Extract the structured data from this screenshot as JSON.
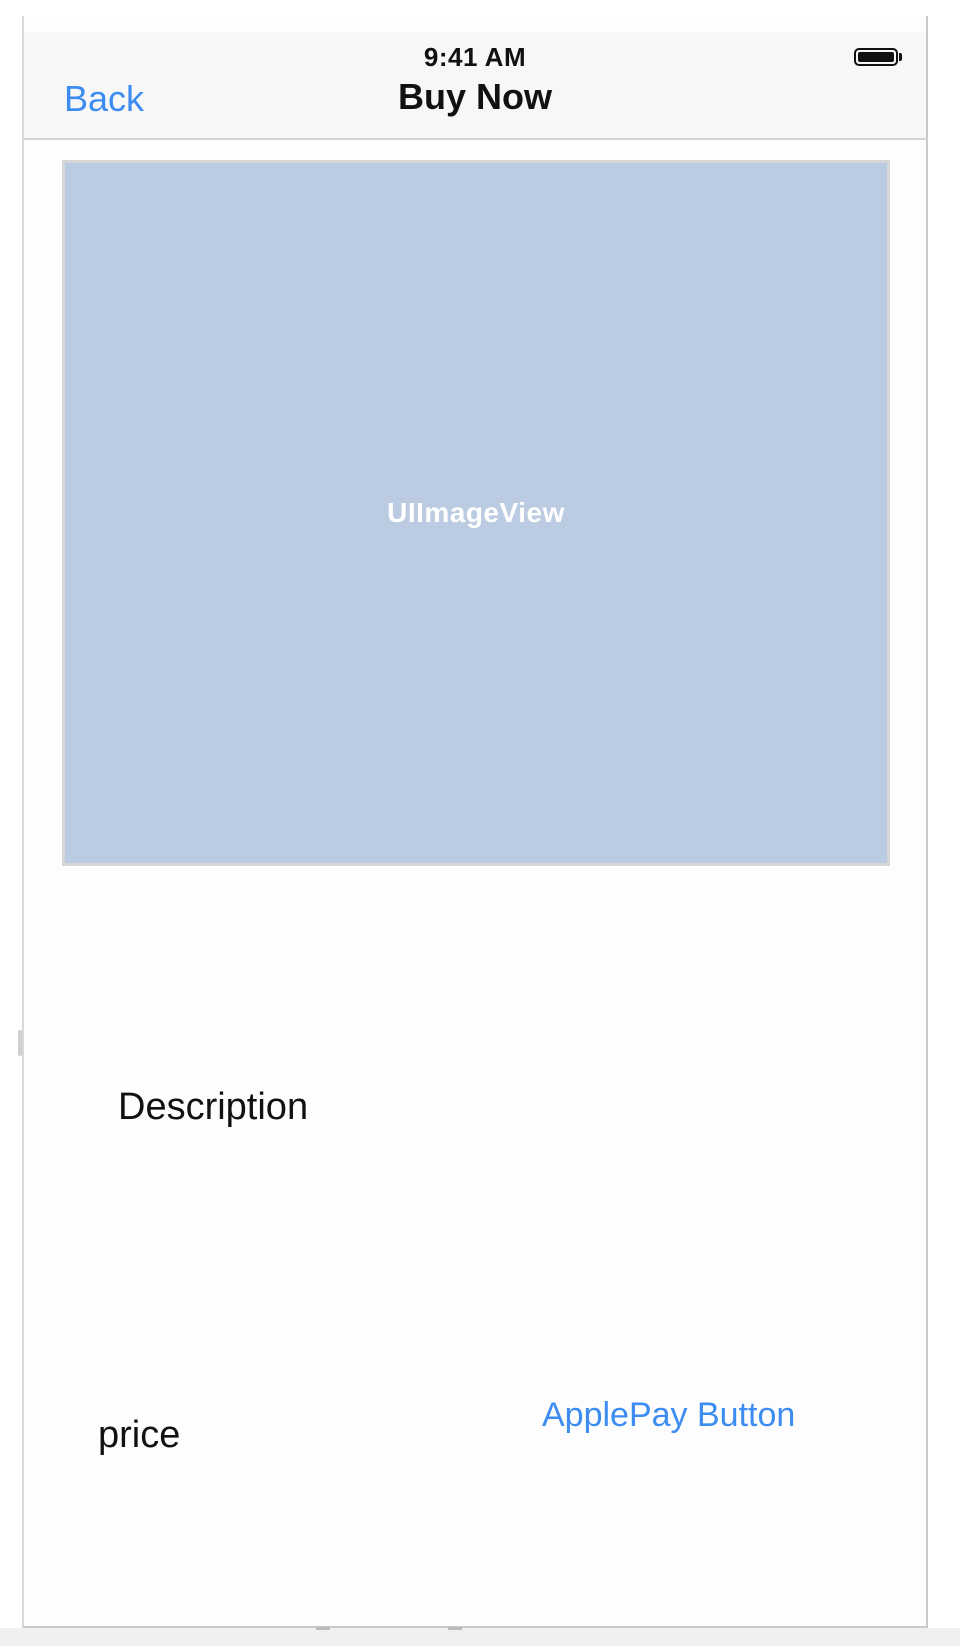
{
  "status_bar": {
    "time": "9:41 AM",
    "battery_icon": "battery-full-icon"
  },
  "navbar": {
    "back_label": "Back",
    "title": "Buy Now"
  },
  "image_view": {
    "caption": "UIImageView",
    "background_color": "#bbcce2"
  },
  "content": {
    "description_label": "Description",
    "price_label": "price",
    "applepay_label": "ApplePay Button"
  },
  "colors": {
    "tint": "#3d8cf2",
    "text": "#111111"
  }
}
